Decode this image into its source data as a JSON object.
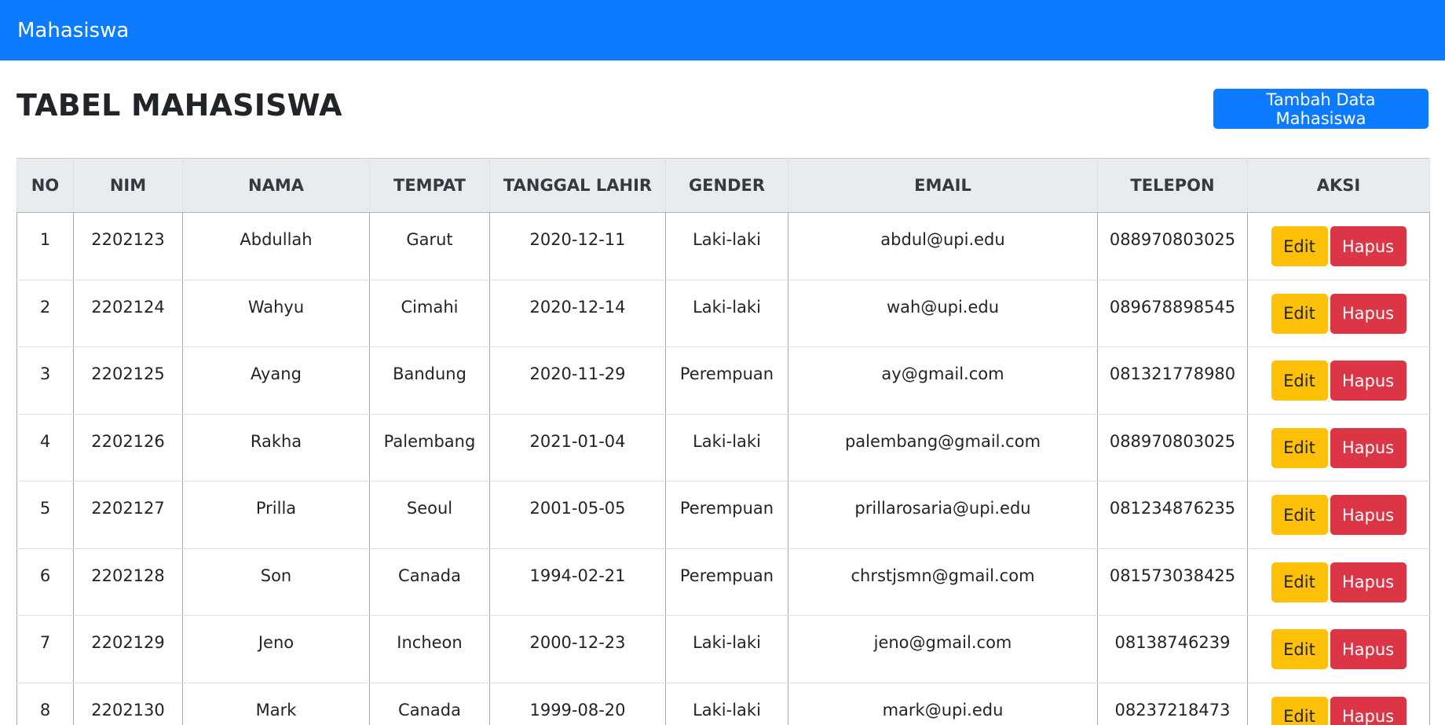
{
  "navbar": {
    "brand": "Mahasiswa",
    "color": "#0d7bfd"
  },
  "page": {
    "title": "TABEL MAHASISWA",
    "add_button_label": "Tambah Data Mahasiswa"
  },
  "table": {
    "headers": [
      "NO",
      "NIM",
      "NAMA",
      "TEMPAT",
      "TANGGAL LAHIR",
      "GENDER",
      "EMAIL",
      "TELEPON",
      "AKSI"
    ],
    "edit_label": "Edit",
    "delete_label": "Hapus",
    "rows": [
      [
        "1",
        "2202123",
        "Abdullah",
        "Garut",
        "2020-12-11",
        "Laki-laki",
        "abdul@upi.edu",
        "088970803025"
      ],
      [
        "2",
        "2202124",
        "Wahyu",
        "Cimahi",
        "2020-12-14",
        "Laki-laki",
        "wah@upi.edu",
        "089678898545"
      ],
      [
        "3",
        "2202125",
        "Ayang",
        "Bandung",
        "2020-11-29",
        "Perempuan",
        "ay@gmail.com",
        "081321778980"
      ],
      [
        "4",
        "2202126",
        "Rakha",
        "Palembang",
        "2021-01-04",
        "Laki-laki",
        "palembang@gmail.com",
        "088970803025"
      ],
      [
        "5",
        "2202127",
        "Prilla",
        "Seoul",
        "2001-05-05",
        "Perempuan",
        "prillarosaria@upi.edu",
        "081234876235"
      ],
      [
        "6",
        "2202128",
        "Son",
        "Canada",
        "1994-02-21",
        "Perempuan",
        "chrstjsmn@gmail.com",
        "081573038425"
      ],
      [
        "7",
        "2202129",
        "Jeno",
        "Incheon",
        "2000-12-23",
        "Laki-laki",
        "jeno@gmail.com",
        "08138746239"
      ],
      [
        "8",
        "2202130",
        "Mark",
        "Canada",
        "1999-08-20",
        "Laki-laki",
        "mark@upi.edu",
        "08237218473"
      ]
    ]
  },
  "colors": {
    "primary": "#0d7bfd",
    "warning": "#ffc107",
    "danger": "#dc3545",
    "header_bg": "#e9ecef"
  }
}
